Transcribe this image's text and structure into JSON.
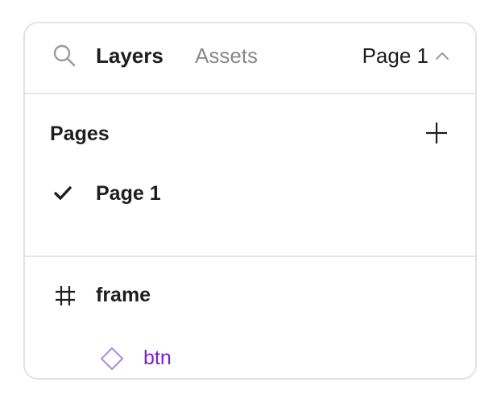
{
  "header": {
    "tabs": [
      {
        "label": "Layers",
        "active": true
      },
      {
        "label": "Assets",
        "active": false
      }
    ],
    "page_selector": {
      "label": "Page 1",
      "icon": "chevron-up-icon"
    },
    "search_icon": "search-icon"
  },
  "pages": {
    "title": "Pages",
    "add_icon": "plus-icon",
    "items": [
      {
        "label": "Page 1",
        "selected": true,
        "icon": "check-icon"
      }
    ]
  },
  "layers": {
    "items": [
      {
        "label": "frame",
        "icon": "frame-hash-icon",
        "type": "frame"
      },
      {
        "label": "btn",
        "icon": "component-diamond-icon",
        "type": "component",
        "color": "#7b1fd4"
      }
    ]
  }
}
